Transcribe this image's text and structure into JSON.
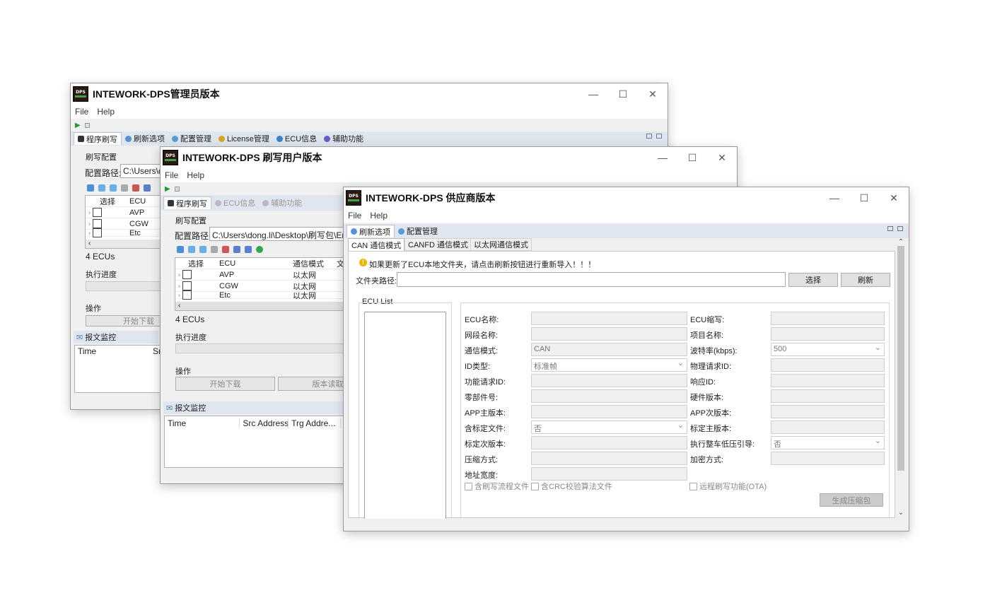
{
  "admin": {
    "title": "INTEWORK-DPS管理员版本",
    "menu": [
      "File",
      "Help"
    ],
    "tabs": [
      {
        "label": "程序刷写",
        "icon": "program-icon"
      },
      {
        "label": "刷新选项",
        "icon": "refresh-icon"
      },
      {
        "label": "配置管理",
        "icon": "config-icon"
      },
      {
        "label": "License管理",
        "icon": "license-icon"
      },
      {
        "label": "ECU信息",
        "icon": "ecu-info-icon"
      },
      {
        "label": "辅助功能",
        "icon": "aux-icon"
      }
    ],
    "flash_config_label": "刷写配置",
    "config_path_label": "配置路径:",
    "config_path_value": "C:\\Users\\d",
    "table_headers": [
      "选择",
      "ECU"
    ],
    "rows": [
      "AVP",
      "CGW",
      "Etc"
    ],
    "ecu_count": "4 ECUs",
    "progress_label": "执行进度",
    "ops_label": "操作",
    "start_download": "开始下载",
    "monitor_label": "报文监控",
    "monitor_headers": [
      "Time",
      "Sr"
    ]
  },
  "user": {
    "title": "INTEWORK-DPS 刷写用户版本",
    "menu": [
      "File",
      "Help"
    ],
    "tabs": [
      {
        "label": "程序刷写",
        "icon": "program-icon"
      },
      {
        "label": "ECU信息",
        "icon": "ecu-info-icon"
      },
      {
        "label": "辅助功能",
        "icon": "aux-icon"
      }
    ],
    "flash_config_label": "刷写配置",
    "config_path_label": "配置路径:",
    "config_path_value": "C:\\Users\\dong.li\\Desktop\\刷写包\\Ent",
    "table_headers": [
      "选择",
      "ECU",
      "通信模式",
      "文"
    ],
    "rows": [
      {
        "ecu": "AVP",
        "mode": "以太网"
      },
      {
        "ecu": "CGW",
        "mode": "以太网"
      },
      {
        "ecu": "Etc",
        "mode": "以太网"
      }
    ],
    "ecu_count": "4 ECUs",
    "progress_label": "执行进度",
    "ops_label": "操作",
    "start_download": "开始下载",
    "version_read": "版本读取",
    "monitor_label": "报文监控",
    "monitor_headers": [
      "Time",
      "Src Address",
      "Trg Addre...",
      "I"
    ]
  },
  "supplier": {
    "title": "INTEWORK-DPS 供应商版本",
    "menu": [
      "File",
      "Help"
    ],
    "tabs": [
      {
        "label": "刷新选项",
        "icon": "refresh-icon"
      },
      {
        "label": "配置管理",
        "icon": "config-icon"
      }
    ],
    "subtabs": [
      "CAN 通信模式",
      "CANFD 通信模式",
      "以太网通信模式"
    ],
    "warning": "如果更新了ECU本地文件夹，请点击刷新按钮进行重新导入！！！",
    "folder_label": "文件夹路径:",
    "folder_value": "",
    "choose_button": "选择",
    "refresh_button": "刷新",
    "ecu_list_label": "ECU List",
    "left_fields": [
      {
        "label": "ECU名称:",
        "value": ""
      },
      {
        "label": "网段名称:",
        "value": ""
      },
      {
        "label": "通信模式:",
        "value": "CAN"
      },
      {
        "label": "ID类型:",
        "value": "标准帧",
        "select": true
      },
      {
        "label": "功能请求ID:",
        "value": ""
      },
      {
        "label": "零部件号:",
        "value": ""
      },
      {
        "label": "APP主版本:",
        "value": ""
      },
      {
        "label": "含标定文件:",
        "value": "否",
        "select": true
      },
      {
        "label": "标定次版本:",
        "value": ""
      },
      {
        "label": "压缩方式:",
        "value": ""
      },
      {
        "label": "地址宽度:",
        "value": ""
      }
    ],
    "right_fields": [
      {
        "label": "ECU缩写:",
        "value": ""
      },
      {
        "label": "项目名称:",
        "value": ""
      },
      {
        "label": "波特率(kbps):",
        "value": "500",
        "select": true
      },
      {
        "label": "物理请求ID:",
        "value": ""
      },
      {
        "label": "响应ID:",
        "value": ""
      },
      {
        "label": "硬件版本:",
        "value": ""
      },
      {
        "label": "APP次版本:",
        "value": ""
      },
      {
        "label": "标定主版本:",
        "value": ""
      },
      {
        "label": "执行整车低压引导:",
        "value": "否",
        "select": true
      },
      {
        "label": "加密方式:",
        "value": ""
      }
    ],
    "checkboxes": [
      "含刷写流程文件",
      "含CRC校验算法文件",
      "远程刷写功能(OTA)"
    ],
    "generate_button": "生成压缩包"
  }
}
